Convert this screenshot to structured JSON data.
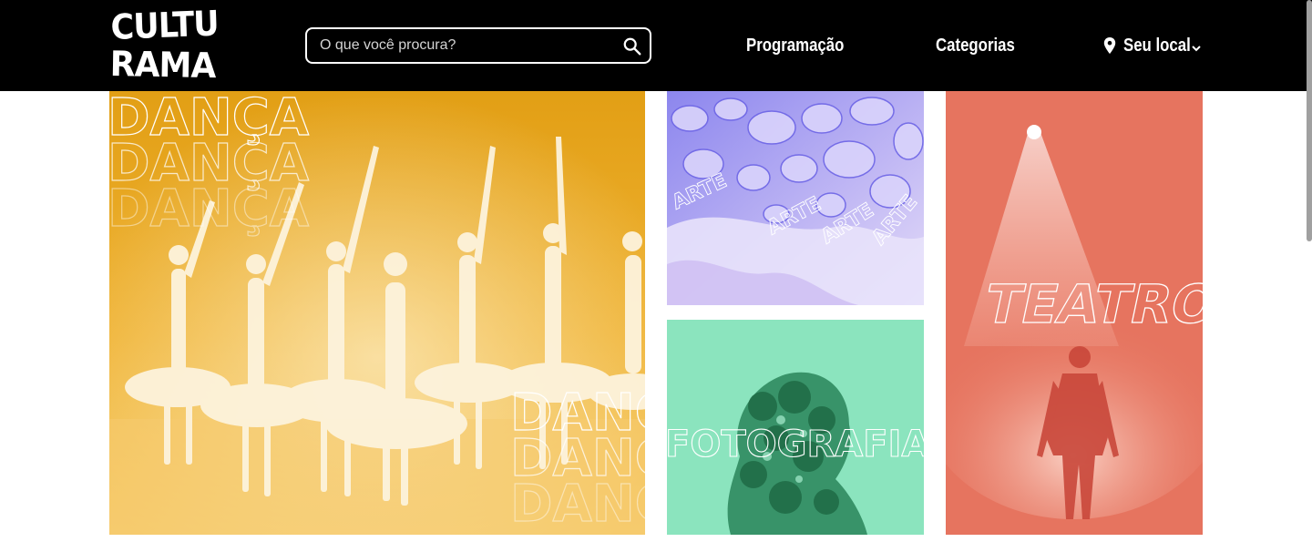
{
  "header": {
    "logo": {
      "line1": "CULTU",
      "line2": "RAMA"
    },
    "search": {
      "placeholder": "O que você procura?",
      "icon": "search-icon"
    },
    "nav": {
      "programacao": "Programação",
      "categorias": "Categorias"
    },
    "location": {
      "label": "Seu local",
      "icon": "map-pin-icon",
      "chevron": "chevron-down-icon"
    }
  },
  "cards": {
    "danca": {
      "label": "DANÇA",
      "color": "#e8a821"
    },
    "arte": {
      "label": "ARTE",
      "color": "#b9aef2"
    },
    "fotografia": {
      "label": "FOTOGRAFIA",
      "color": "#8be4be"
    },
    "teatro": {
      "label": "TEATRO",
      "color": "#e6745f"
    }
  },
  "colors": {
    "header_bg": "#000000",
    "header_text": "#ffffff"
  }
}
